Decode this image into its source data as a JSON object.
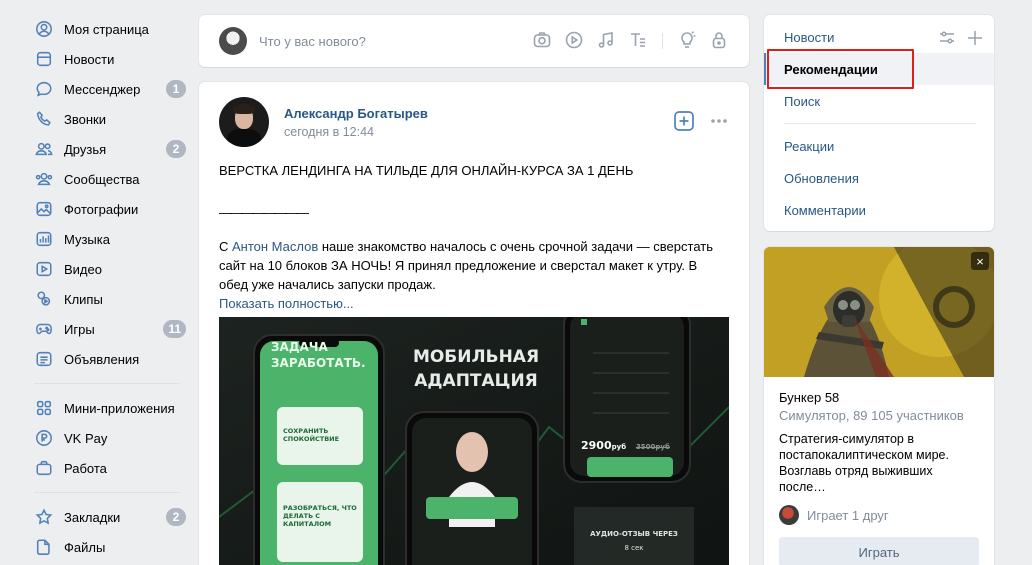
{
  "nav": {
    "items": [
      {
        "label": "Моя страница",
        "icon": "profile-icon"
      },
      {
        "label": "Новости",
        "icon": "news-icon"
      },
      {
        "label": "Мессенджер",
        "icon": "messenger-icon",
        "badge": "1"
      },
      {
        "label": "Звонки",
        "icon": "phone-icon"
      },
      {
        "label": "Друзья",
        "icon": "friends-icon",
        "badge": "2"
      },
      {
        "label": "Сообщества",
        "icon": "communities-icon"
      },
      {
        "label": "Фотографии",
        "icon": "photos-icon"
      },
      {
        "label": "Музыка",
        "icon": "music-icon"
      },
      {
        "label": "Видео",
        "icon": "video-icon"
      },
      {
        "label": "Клипы",
        "icon": "clips-icon"
      },
      {
        "label": "Игры",
        "icon": "games-icon",
        "badge": "11"
      },
      {
        "label": "Объявления",
        "icon": "ads-icon"
      }
    ],
    "items2": [
      {
        "label": "Мини-приложения",
        "icon": "apps-icon"
      },
      {
        "label": "VK Pay",
        "icon": "vkpay-icon"
      },
      {
        "label": "Работа",
        "icon": "work-icon"
      }
    ],
    "items3": [
      {
        "label": "Закладки",
        "icon": "bookmark-icon",
        "badge": "2"
      },
      {
        "label": "Файлы",
        "icon": "files-icon"
      }
    ]
  },
  "composer": {
    "placeholder": "Что у вас нового?"
  },
  "post": {
    "author": "Александр Богатырев",
    "time": "сегодня в 12:44",
    "title": "ВЕРСТКА ЛЕНДИНГА НА ТИЛЬДЕ ДЛЯ ОНЛАЙН-КУРСА ЗА 1 ДЕНЬ",
    "divider": "————————",
    "text_prefix": "С ",
    "mention": "Антон Маслов",
    "text_1": " наше знакомство началось с очень срочной задачи — сверстать",
    "text_2": "сайт на 10 блоков ЗА НОЧЬ! Я принял предложение и сверстал макет к утру. В",
    "text_3": "обед уже начались запуски продаж.",
    "show_more": "Показать полностью...",
    "image": {
      "heading_1": "МОБИЛЬНАЯ",
      "heading_2": "АДАПТАЦИЯ",
      "phone_left_title_1": "ЗАДАЧА",
      "phone_left_title_2": "ЗАРАБОТАТЬ.",
      "card_1": "СОХРАНИТЬ СПОКОЙСТВИЕ",
      "card_2": "РАЗОБРАТЬСЯ, ЧТО ДЕЛАТЬ С КАПИТАЛОМ",
      "price": "2900",
      "price_unit": "руб",
      "old_price": "3500руб",
      "audio_1": "АУДИО-ОТЗЫВ ЧЕРЕЗ",
      "audio_2": "8 сек"
    }
  },
  "right_menu": {
    "items": [
      {
        "label": "Новости"
      },
      {
        "label": "Рекомендации"
      },
      {
        "label": "Поиск"
      },
      {
        "label": "Реакции"
      },
      {
        "label": "Обновления"
      },
      {
        "label": "Комментарии"
      }
    ]
  },
  "game": {
    "close": "×",
    "title": "Бункер 58",
    "subtitle": "Симулятор, 89 105 участников",
    "desc_1": "Стратегия-симулятор в",
    "desc_2": "постапокалиптическом мире.",
    "desc_3": "Возглавь отряд выживших после…",
    "friends": "Играет 1 друг",
    "button": "Играть"
  },
  "colors": {
    "accent": "#2a5885",
    "badge": "#aeb7c2",
    "highlight": "#e01e1e",
    "green": "#4bb34b"
  }
}
